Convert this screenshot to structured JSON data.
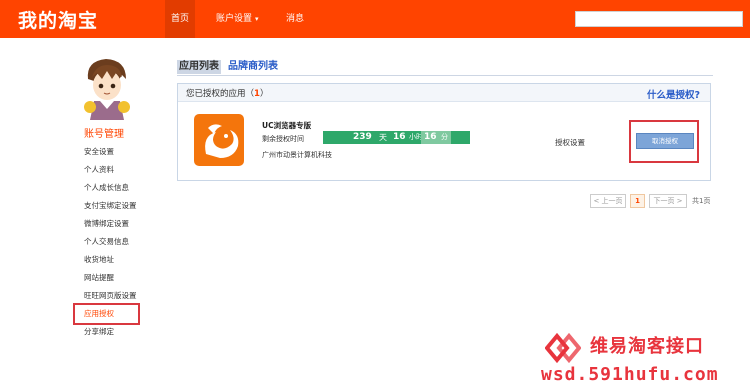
{
  "header": {
    "logo": "我的淘宝",
    "nav": [
      {
        "label": "首页",
        "active": true
      },
      {
        "label": "账户设置",
        "dropdown": true
      },
      {
        "label": "消息"
      }
    ],
    "search_value": ""
  },
  "sidebar": {
    "title": "账号管理",
    "items": [
      {
        "label": "安全设置"
      },
      {
        "label": "个人资料"
      },
      {
        "label": "个人成长信息"
      },
      {
        "label": "支付宝绑定设置"
      },
      {
        "label": "微博绑定设置"
      },
      {
        "label": "个人交易信息"
      },
      {
        "label": "收货地址"
      },
      {
        "label": "网站提醒"
      },
      {
        "label": "旺旺网页版设置"
      },
      {
        "label": "应用授权",
        "selected": true
      },
      {
        "label": "分享绑定"
      }
    ]
  },
  "main": {
    "tabs": [
      {
        "label": "应用列表",
        "active": true
      },
      {
        "label": "品牌商列表"
      }
    ],
    "panel": {
      "title_prefix": "您已授权的应用（",
      "count": "1",
      "title_suffix": "）",
      "help_link": "什么是授权?",
      "app": {
        "name": "UC浏览器专版",
        "remaining_label": "剩余授权时间",
        "days": "239",
        "days_unit": "天",
        "hours": "16",
        "hours_unit": "小时",
        "minutes": "16",
        "minutes_unit": "分",
        "company": "广州市动景计算机科技",
        "settings_link": "授权设置",
        "cancel_button": "取消授权"
      }
    },
    "pagination": {
      "prev": "< 上一页",
      "current": "1",
      "next": "下一页 >",
      "total": "共1页"
    }
  },
  "watermark": {
    "title": "维易淘客接口",
    "url": "wsd.591hufu.com"
  },
  "colors": {
    "brand": "#ff4400",
    "timer_green": "#2ea86a",
    "highlight_red": "#d9383f",
    "link_blue": "#2a5cc8",
    "watermark_red": "#e8343d"
  }
}
